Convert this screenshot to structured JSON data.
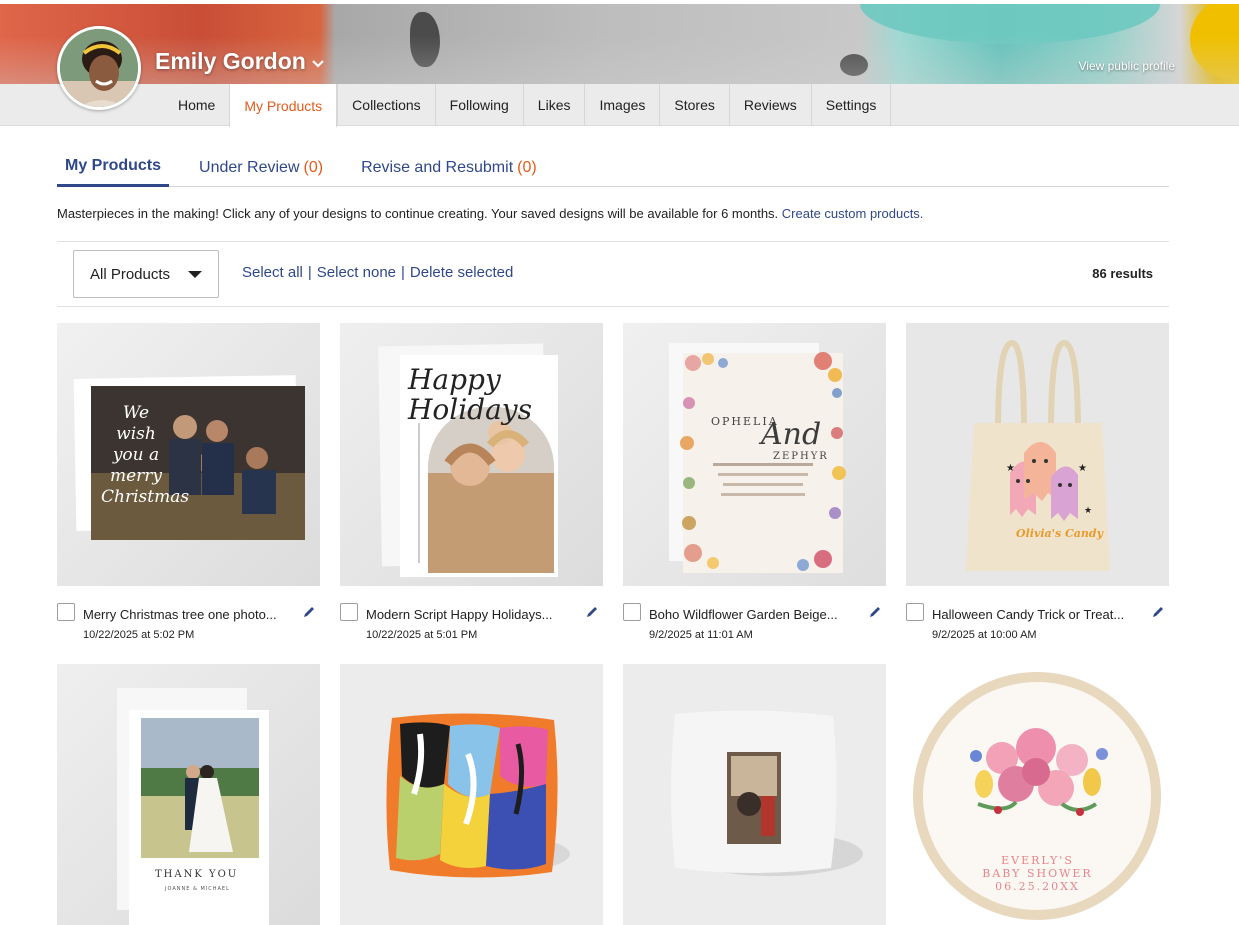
{
  "profile": {
    "name": "Emily Gordon",
    "view_public": "View public profile"
  },
  "nav": {
    "tabs": [
      {
        "label": "Home"
      },
      {
        "label": "My Products",
        "active": true
      },
      {
        "label": "Collections"
      },
      {
        "label": "Following"
      },
      {
        "label": "Likes"
      },
      {
        "label": "Images"
      },
      {
        "label": "Stores"
      },
      {
        "label": "Reviews"
      },
      {
        "label": "Settings"
      }
    ]
  },
  "subtabs": [
    {
      "label": "My Products",
      "count": ""
    },
    {
      "label": "Under Review",
      "count": "(0)"
    },
    {
      "label": "Revise and Resubmit",
      "count": "(0)"
    }
  ],
  "intro": {
    "text": "Masterpieces in the making! Click any of your designs to continue creating. Your saved designs will be available for 6 months.",
    "link": "Create custom products."
  },
  "toolbar": {
    "filter_value": "All Products",
    "select_all": "Select all",
    "select_none": "Select none",
    "delete_selected": "Delete selected",
    "separator": "|",
    "results": "86 results"
  },
  "products": [
    {
      "title": "Merry Christmas tree one photo...",
      "date": "10/22/2025 at 5:02 PM",
      "icon": "pencil-icon"
    },
    {
      "title": "Modern Script Happy Holidays...",
      "date": "10/22/2025 at 5:01 PM",
      "icon": "pencil-icon"
    },
    {
      "title": "Boho Wildflower Garden Beige...",
      "date": "9/2/2025 at 11:01 AM",
      "icon": "pencil-icon"
    },
    {
      "title": "Halloween Candy Trick or Treat...",
      "date": "9/2/2025 at 10:00 AM",
      "icon": "pencil-icon"
    },
    {
      "title": "",
      "date": ""
    },
    {
      "title": "",
      "date": ""
    },
    {
      "title": "",
      "date": ""
    },
    {
      "title": "",
      "date": ""
    }
  ],
  "thumb_text": {
    "card1_script": "We wish you a merry Christmas",
    "card2_script": "Happy Holidays",
    "card3_names": "OPHELIA",
    "card3_and": "And",
    "card3_name2": "ZEPHYR",
    "card4_label": "Olivia's Candy",
    "card5_caption": "THANK YOU",
    "card5_sub": "JOANNE & MICHAEL",
    "card8_line1": "EVERLY'S",
    "card8_line2": "BABY SHOWER",
    "card8_line3": "06.25.20XX"
  },
  "colors": {
    "accent": "#e25b1c",
    "link": "#30488a"
  }
}
